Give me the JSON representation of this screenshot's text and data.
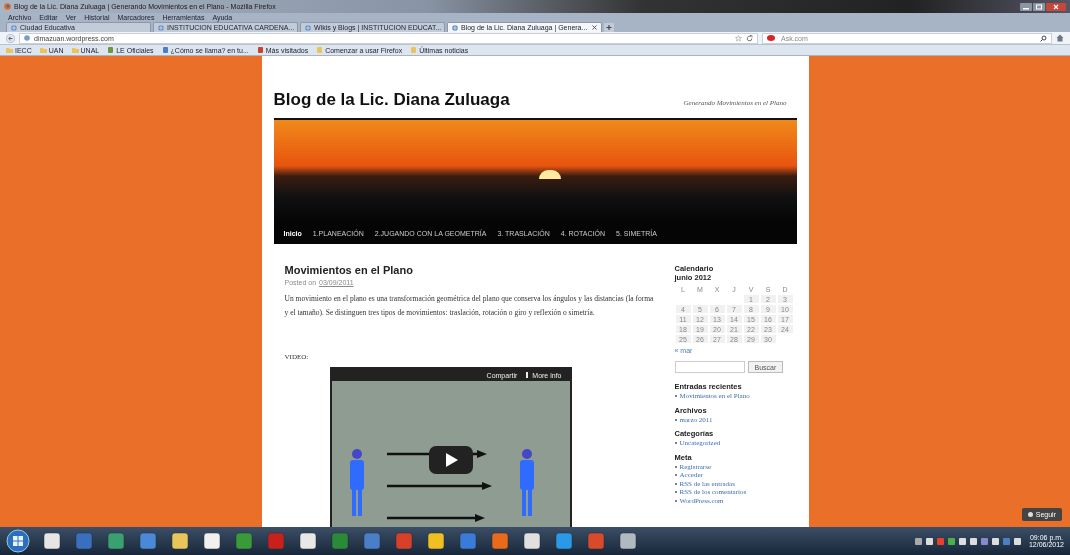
{
  "window": {
    "title": "Blog de la Lic. Diana Zuluaga | Generando Movimientos en el Plano - Mozilla Firefox"
  },
  "menu": [
    "Archivo",
    "Editar",
    "Ver",
    "Historial",
    "Marcadores",
    "Herramientas",
    "Ayuda"
  ],
  "tabs": [
    {
      "label": "Ciudad Educativa",
      "selected": false
    },
    {
      "label": "INSTITUCION EDUCATIVA CARDENA...",
      "selected": false
    },
    {
      "label": "Wikis y Blogs | INSTITUCION EDUCAT...",
      "selected": false
    },
    {
      "label": "Blog de la Lic. Diana Zuluaga | Genera...",
      "selected": true
    }
  ],
  "address": {
    "url": "dimazuan.wordpress.com"
  },
  "search": {
    "placeholder": "Ask.com"
  },
  "bookmarks": [
    "IECC",
    "UAN",
    "UNAL",
    "LE Oficiales",
    "¿Cómo se llama? en tu...",
    "Más visitados",
    "Comenzar a usar Firefox",
    "Últimas noticias"
  ],
  "blog": {
    "title": "Blog de la Lic. Diana Zuluaga",
    "tagline": "Generando Movimientos en el Plano",
    "nav": [
      {
        "label": "Inicio",
        "selected": true
      },
      {
        "label": "1.PLANEACIÓN",
        "selected": false
      },
      {
        "label": "2.JUGANDO CON LA GEOMETRÍA",
        "selected": false
      },
      {
        "label": "3. TRASLACIÓN",
        "selected": false
      },
      {
        "label": "4. ROTACIÓN",
        "selected": false
      },
      {
        "label": "5. SIMETRÍA",
        "selected": false
      }
    ],
    "post": {
      "title": "Movimientos en el Plano",
      "posted_label": "Posted on",
      "date": "03/09/2011",
      "body": "Un movimiento en el plano es una transformación geométrica del plano que conserva los ángulos y las distancias (la forma y el tamaño). Se distinguen tres tipos de movimientos: traslación, rotación o giro y reflexión o simetría.",
      "video_label": "VIDEO:",
      "video": {
        "share": "Compartir",
        "info": "More info"
      }
    }
  },
  "sidebar": {
    "calendar": {
      "title": "Calendario",
      "month": "junio 2012",
      "weekdays": [
        "L",
        "M",
        "X",
        "J",
        "V",
        "S",
        "D"
      ],
      "weeks": [
        [
          {
            "kind": "blank"
          },
          {
            "kind": "blank"
          },
          {
            "kind": "blank"
          },
          {
            "kind": "blank"
          },
          {
            "kind": "day",
            "label": "1"
          },
          {
            "kind": "day",
            "label": "2"
          },
          {
            "kind": "day",
            "label": "3"
          }
        ],
        [
          {
            "kind": "day",
            "label": "4"
          },
          {
            "kind": "day",
            "label": "5"
          },
          {
            "kind": "day",
            "label": "6"
          },
          {
            "kind": "day",
            "label": "7"
          },
          {
            "kind": "day",
            "label": "8"
          },
          {
            "kind": "day",
            "label": "9"
          },
          {
            "kind": "day",
            "label": "10"
          }
        ],
        [
          {
            "kind": "day",
            "label": "11"
          },
          {
            "kind": "day",
            "label": "12"
          },
          {
            "kind": "day",
            "label": "13"
          },
          {
            "kind": "day",
            "label": "14"
          },
          {
            "kind": "day",
            "label": "15"
          },
          {
            "kind": "day",
            "label": "16"
          },
          {
            "kind": "day",
            "label": "17"
          }
        ],
        [
          {
            "kind": "day",
            "label": "18"
          },
          {
            "kind": "day",
            "label": "19"
          },
          {
            "kind": "day",
            "label": "20"
          },
          {
            "kind": "day",
            "label": "21"
          },
          {
            "kind": "day",
            "label": "22"
          },
          {
            "kind": "day",
            "label": "23"
          },
          {
            "kind": "day",
            "label": "24"
          }
        ],
        [
          {
            "kind": "day",
            "label": "25"
          },
          {
            "kind": "day",
            "label": "26"
          },
          {
            "kind": "day",
            "label": "27"
          },
          {
            "kind": "day",
            "label": "28"
          },
          {
            "kind": "day",
            "label": "29"
          },
          {
            "kind": "day",
            "label": "30"
          },
          {
            "kind": "blank"
          }
        ]
      ],
      "prev": "« mar"
    },
    "search_button": "Buscar",
    "widgets": [
      {
        "title": "Entradas recientes",
        "links": [
          "Movimientos en el Plano"
        ]
      },
      {
        "title": "Archivos",
        "links": [
          "marzo 2011"
        ]
      },
      {
        "title": "Categorías",
        "links": [
          "Uncategorized"
        ]
      },
      {
        "title": "Meta",
        "links": [
          "Registrarse",
          "Acceder",
          "RSS de las entradas",
          "RSS de los comentarios",
          "WordPress.com"
        ]
      }
    ]
  },
  "follow_button": "Seguir",
  "taskbar": {
    "time": "09:06 p.m.",
    "date": "12/06/2012"
  }
}
